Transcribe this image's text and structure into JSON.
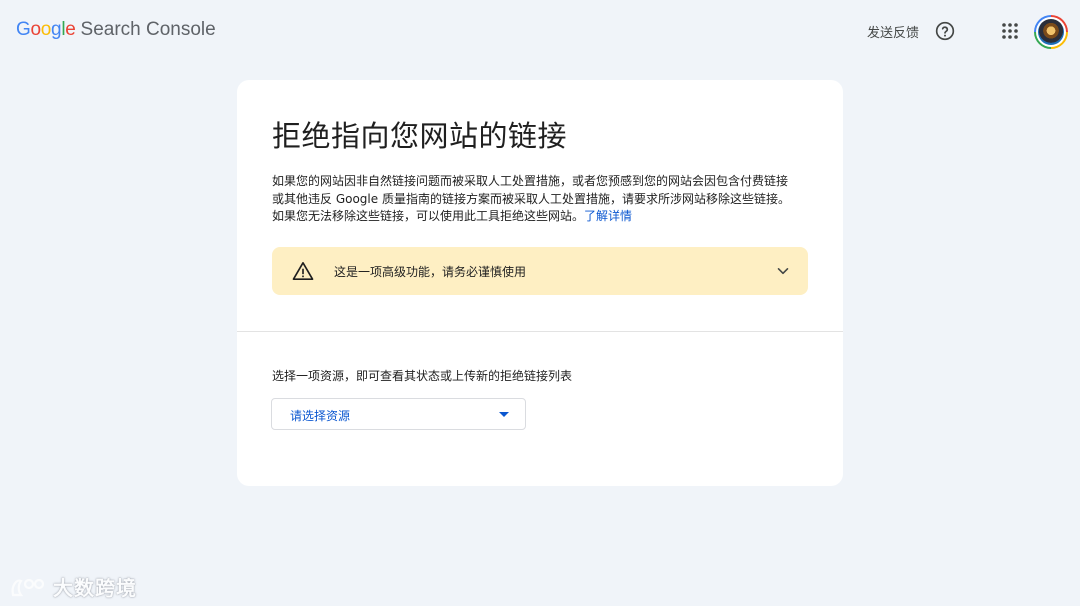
{
  "header": {
    "logo_google": [
      "G",
      "o",
      "o",
      "g",
      "l",
      "e"
    ],
    "logo_product": "Search Console",
    "feedback_label": "发送反馈",
    "icons": {
      "help": "help-circle-icon",
      "apps": "apps-grid-icon",
      "avatar": "user-avatar"
    }
  },
  "card": {
    "title": "拒绝指向您网站的链接",
    "description": "如果您的网站因非自然链接问题而被采取人工处置措施，或者您预感到您的网站会因包含付费链接或其他违反 Google 质量指南的链接方案而被采取人工处置措施，请要求所涉网站移除这些链接。如果您无法移除这些链接，可以使用此工具拒绝这些网站。",
    "learn_more": "了解详情",
    "warning": {
      "text": "这是一项高级功能，请务必谨慎使用",
      "color": "#feefc3",
      "icon": "warning-triangle-icon"
    },
    "select_label": "选择一项资源，即可查看其状态或上传新的拒绝链接列表",
    "select_placeholder": "请选择资源"
  },
  "watermark": {
    "text": "大数跨境"
  },
  "colors": {
    "background": "#f0f4f9",
    "card": "#ffffff",
    "link": "#0b57d0"
  }
}
